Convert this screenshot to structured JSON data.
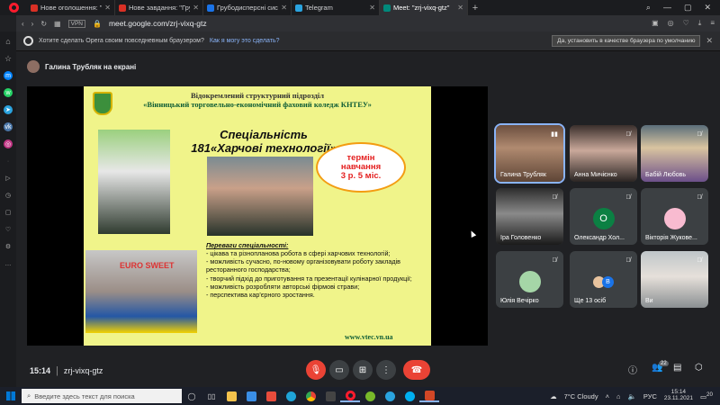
{
  "tabs": [
    {
      "label": "Нове оголошення: \"Добр",
      "color": "#d93025",
      "active": false
    },
    {
      "label": "Нове завдання: \"Грубодр",
      "color": "#d93025",
      "active": false
    },
    {
      "label": "Грубодисперсні системи.",
      "color": "#1a73e8",
      "active": false
    },
    {
      "label": "Telegram",
      "color": "#2aa3df",
      "active": false
    },
    {
      "label": "Meet: \"zrj-vixq-gtz\"",
      "color": "#00897b",
      "active": true
    }
  ],
  "address": {
    "url": "meet.google.com/zrj-vixq-gtz",
    "vpn_label": "VPN"
  },
  "banner": {
    "text": "Хотите сделать Opera своим повседневным браузером?",
    "link": "Как я могу это сделать?",
    "button": "Да, установить в качестве браузера по умолчанию"
  },
  "presenter": {
    "name": "Галина Трубляк на екрані"
  },
  "slide": {
    "header_line1": "Відокремлений структурний підрозділ",
    "header_line2": "«Вінницький торговельно-економічний фаховий коледж КНТЕУ»",
    "title_line1": "Спеціальність",
    "title_line2": "181«Харчові технології»",
    "term_line1": "термін",
    "term_line2": "навчання",
    "term_line3": "3 р. 5 міс.",
    "photo_caption": "EURO SWEET",
    "adv_title": "Переваги спеціальності:",
    "adv_items": [
      "- цікава та різнопланова робота в сфері харчових технологій;",
      "- можливість сучасно, по-новому організовувати роботу закладів ресторанного господарства;",
      "- творчий підхід до приготування та презентації кулінарної продукції;",
      "- можливість розробляти авторські фірмові страви;",
      "- перспектива кар'єрного зростання."
    ],
    "url": "www.vtec.vn.ua"
  },
  "participants": [
    {
      "name": "Галина Трубляк",
      "kind": "camera",
      "speaking": true
    },
    {
      "name": "Анна Мичієнко",
      "kind": "camera",
      "speaking": false
    },
    {
      "name": "Бабій Любовь",
      "kind": "camera",
      "speaking": false
    },
    {
      "name": "Іра Головенко",
      "kind": "camera",
      "speaking": false
    },
    {
      "name": "Олександр Хол...",
      "kind": "avatar",
      "initial": "О",
      "avatar_color": "#0b8043",
      "speaking": false
    },
    {
      "name": "Вікторія Жукове...",
      "kind": "avatar",
      "initial": "",
      "avatar_color": "#f8bbd0",
      "speaking": false
    },
    {
      "name": "Юлія Вечірко",
      "kind": "avatar",
      "initial": "",
      "avatar_color": "#a5d6a7",
      "speaking": false
    },
    {
      "name": "Ще 13 осіб",
      "kind": "group",
      "speaking": false
    },
    {
      "name": "Ви",
      "kind": "camera",
      "speaking": false
    }
  ],
  "meeting": {
    "time": "15:14",
    "code": "zrj-vixq-gtz",
    "people_count": "22"
  },
  "taskbar": {
    "search_placeholder": "Введите здесь текст для поиска",
    "weather": "7°C  Cloudy",
    "lang": "РУС",
    "time": "15:14",
    "date": "23.11.2021",
    "notif_count": "20"
  }
}
